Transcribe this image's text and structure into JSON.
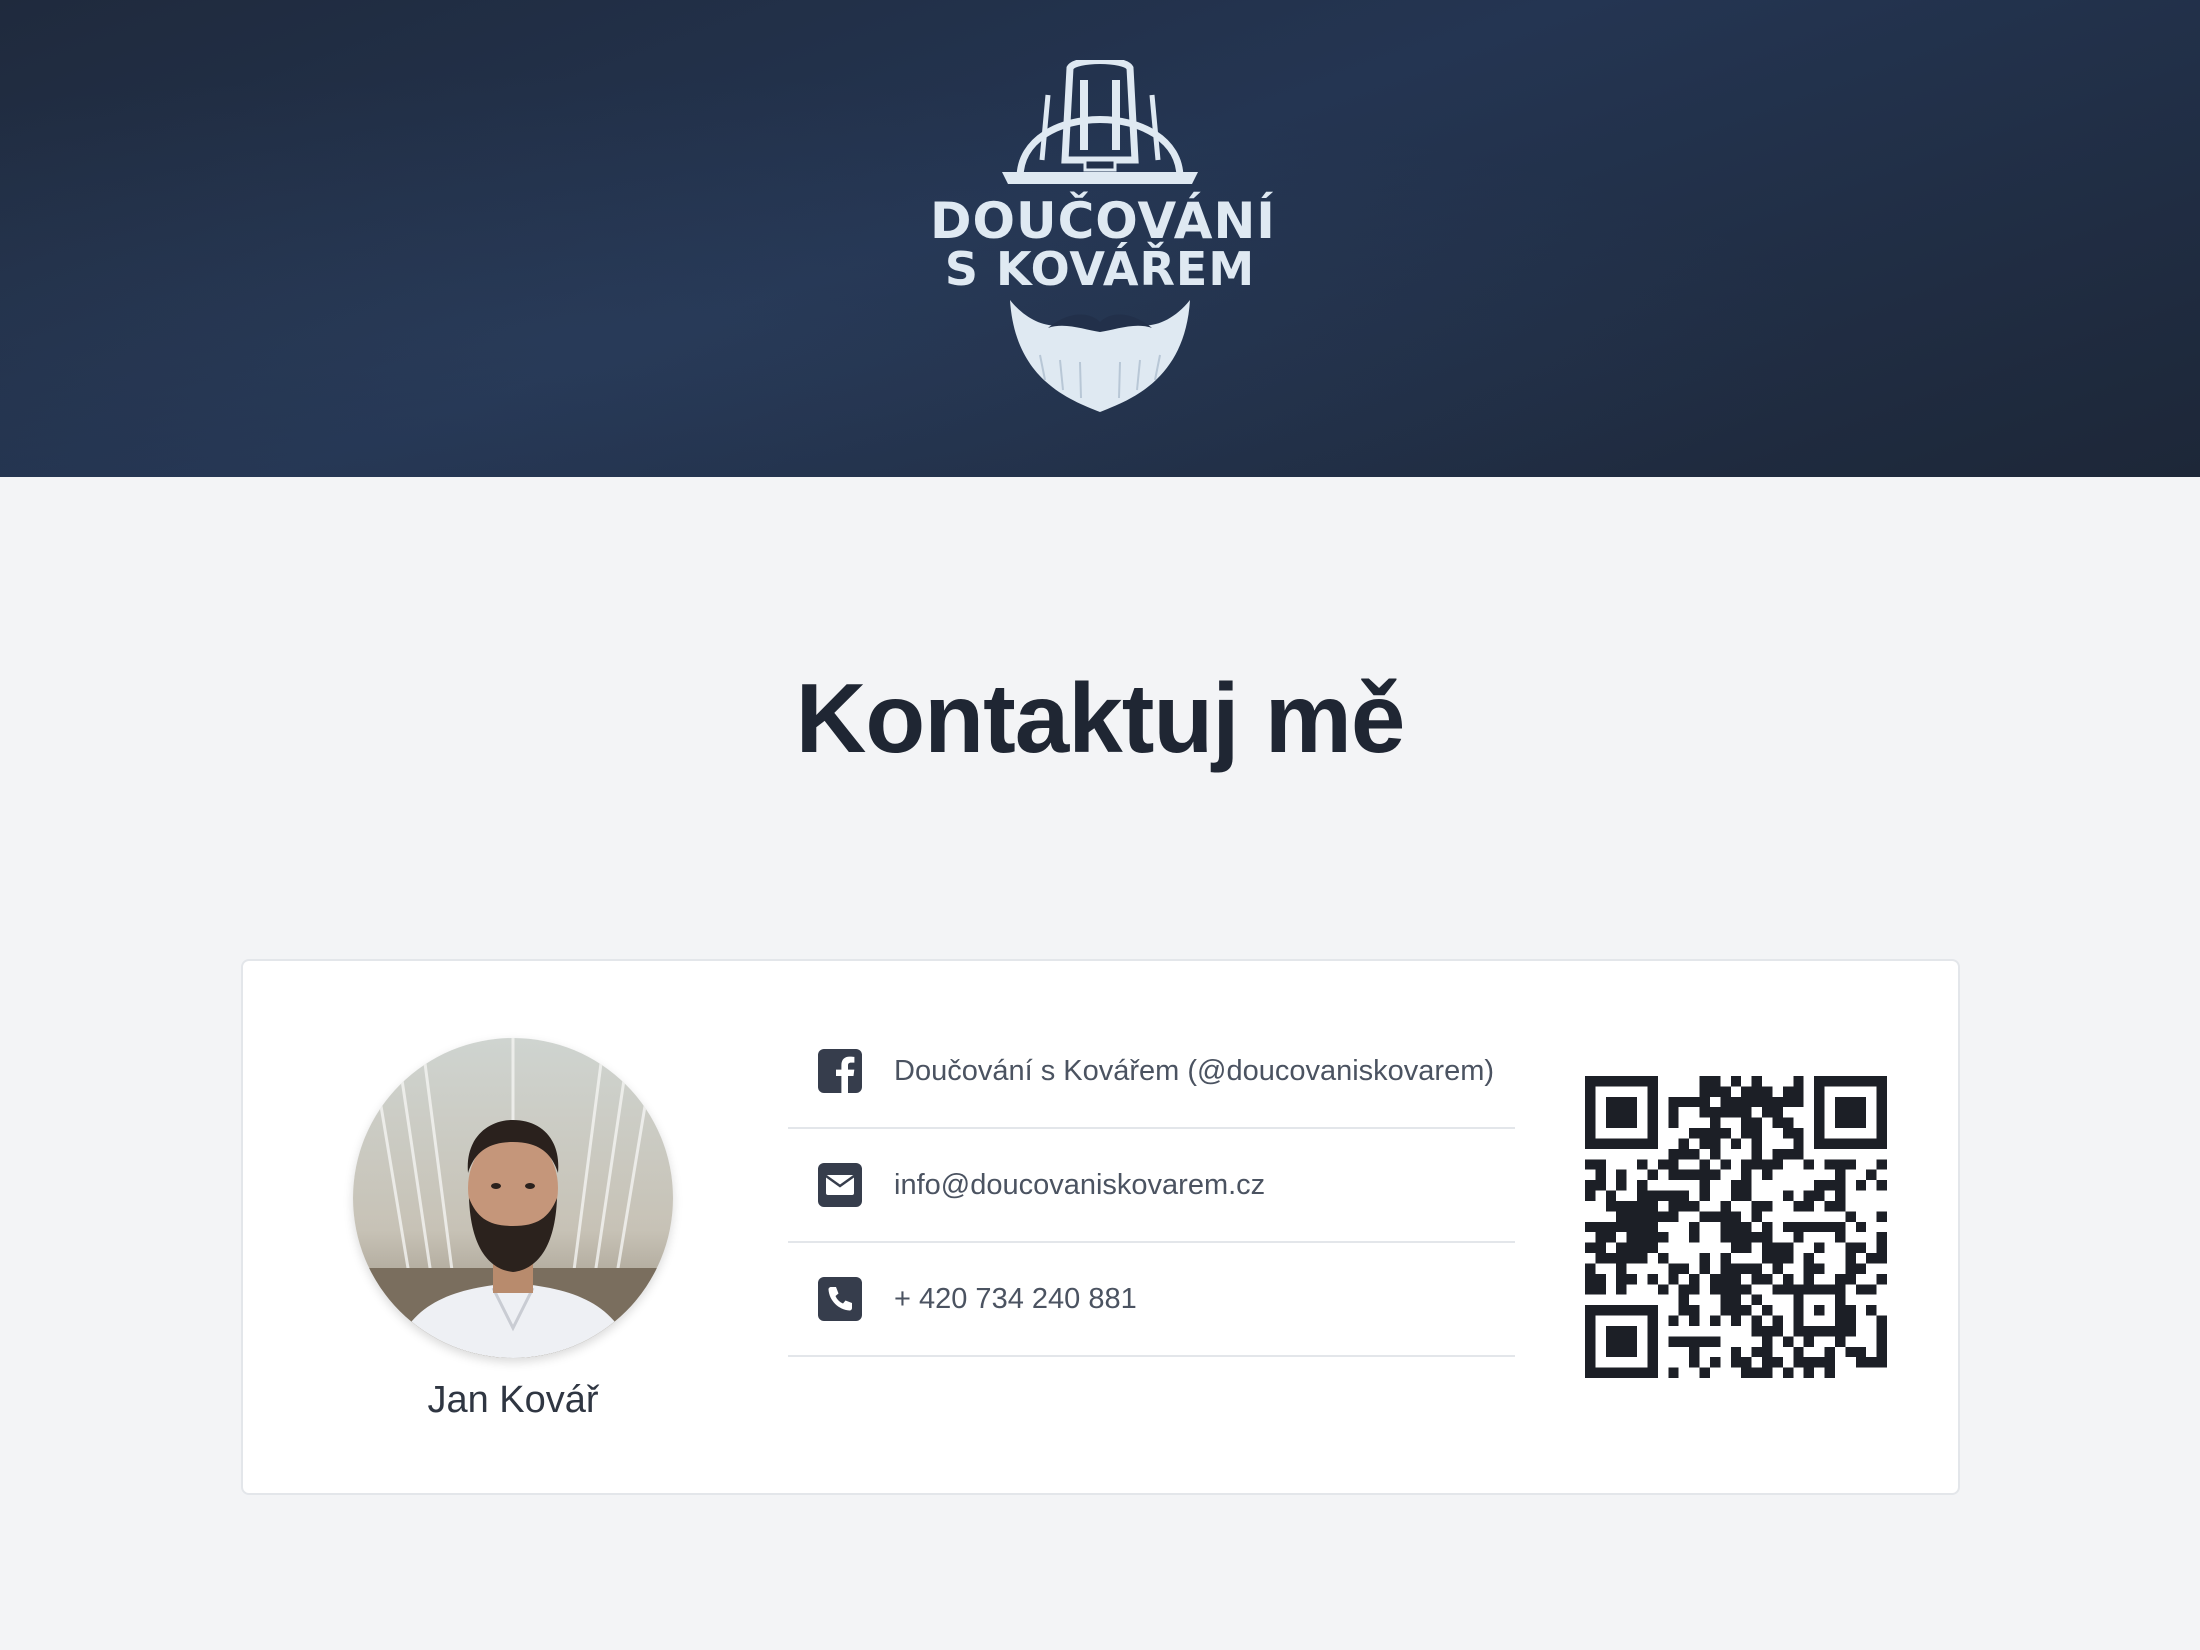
{
  "header": {
    "logo_line1": "DOUČOVÁNÍ",
    "logo_line2": "S KOVÁŘEM"
  },
  "page": {
    "heading": "Kontaktuj mě"
  },
  "profile": {
    "name": "Jan Kovář"
  },
  "contacts": [
    {
      "icon": "facebook-icon",
      "text": "Doučování s Kovářem (@doucovaniskovarem)"
    },
    {
      "icon": "envelope-icon",
      "text": "info@doucovaniskovarem.cz"
    },
    {
      "icon": "phone-icon",
      "text": "+ 420 734 240 881"
    }
  ],
  "colors": {
    "header_bg": "#22304a",
    "page_bg": "#f3f4f6",
    "heading": "#1f2633",
    "icon": "#363d4c",
    "text": "#4b5361"
  }
}
